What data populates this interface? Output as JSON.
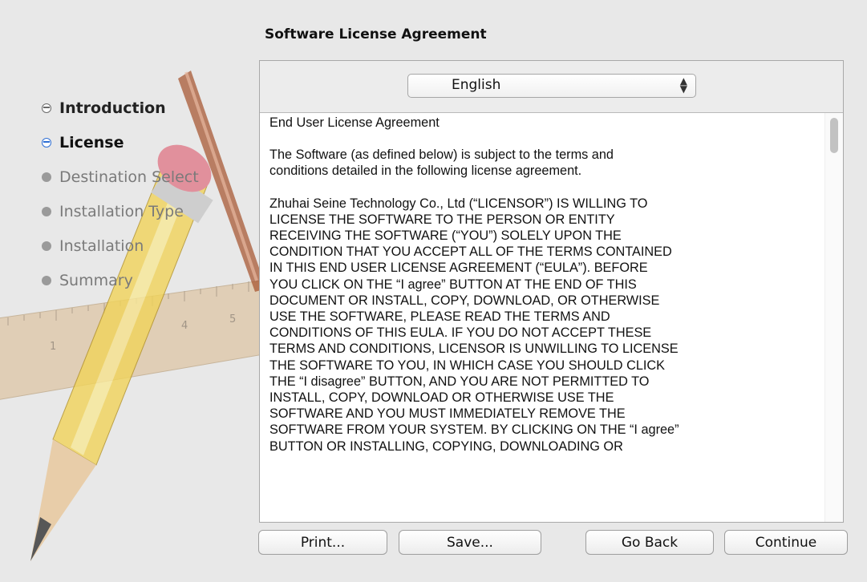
{
  "page": {
    "title": "Software License Agreement"
  },
  "steps": [
    {
      "label": "Introduction",
      "state": "done"
    },
    {
      "label": "License",
      "state": "current"
    },
    {
      "label": "Destination Select",
      "state": "pending"
    },
    {
      "label": "Installation Type",
      "state": "pending"
    },
    {
      "label": "Installation",
      "state": "pending"
    },
    {
      "label": "Summary",
      "state": "pending"
    }
  ],
  "language": {
    "selected": "English"
  },
  "license": {
    "heading": "End User License Agreement",
    "paragraphs": [
      "The Software (as defined below) is subject to the terms and\nconditions detailed in the following license agreement.",
      "Zhuhai Seine Technology Co., Ltd (“LICENSOR”) IS WILLING TO\nLICENSE THE SOFTWARE TO THE PERSON OR ENTITY\nRECEIVING THE SOFTWARE (“YOU”) SOLELY UPON THE\nCONDITION THAT YOU ACCEPT ALL OF THE TERMS CONTAINED\nIN THIS END USER LICENSE AGREEMENT (“EULA”).  BEFORE\nYOU CLICK ON THE “I agree” BUTTON AT THE END OF THIS\nDOCUMENT OR INSTALL, COPY, DOWNLOAD, OR OTHERWISE\nUSE THE SOFTWARE, PLEASE READ THE TERMS AND\nCONDITIONS OF THIS EULA.  IF YOU DO NOT ACCEPT THESE\nTERMS AND CONDITIONS, LICENSOR IS UNWILLING TO LICENSE\nTHE SOFTWARE TO YOU, IN WHICH CASE YOU SHOULD CLICK\nTHE “I disagree” BUTTON, AND YOU ARE NOT PERMITTED TO\nINSTALL, COPY, DOWNLOAD OR OTHERWISE USE THE\nSOFTWARE AND YOU MUST IMMEDIATELY REMOVE THE\nSOFTWARE FROM YOUR SYSTEM.  BY CLICKING ON THE “I agree”\nBUTTON OR INSTALLING, COPYING, DOWNLOADING OR"
    ]
  },
  "ruler_numbers": [
    "1",
    "4",
    "5"
  ],
  "buttons": {
    "print": "Print...",
    "save": "Save...",
    "go_back": "Go Back",
    "continue": "Continue"
  },
  "icons": [
    "pencil-icon",
    "ruler-icon",
    "chevron-updown-icon"
  ]
}
